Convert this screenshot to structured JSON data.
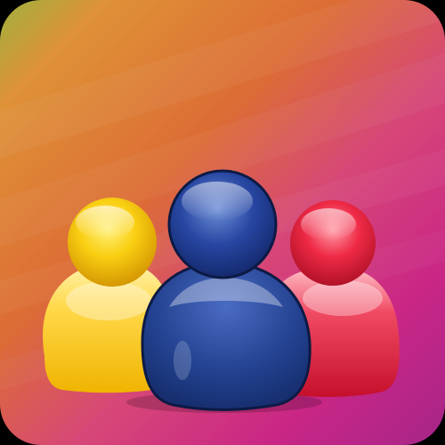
{
  "icon": {
    "name": "group-users-app-icon",
    "figures": [
      {
        "name": "yellow-user",
        "color": "#f5c400"
      },
      {
        "name": "blue-user",
        "color": "#1d3c8f"
      },
      {
        "name": "red-user",
        "color": "#e3193c"
      }
    ],
    "background_gradient": [
      "#a8c83a",
      "#f2a431",
      "#ee7a2f",
      "#e8507a",
      "#d92a8a",
      "#b0288f"
    ]
  }
}
